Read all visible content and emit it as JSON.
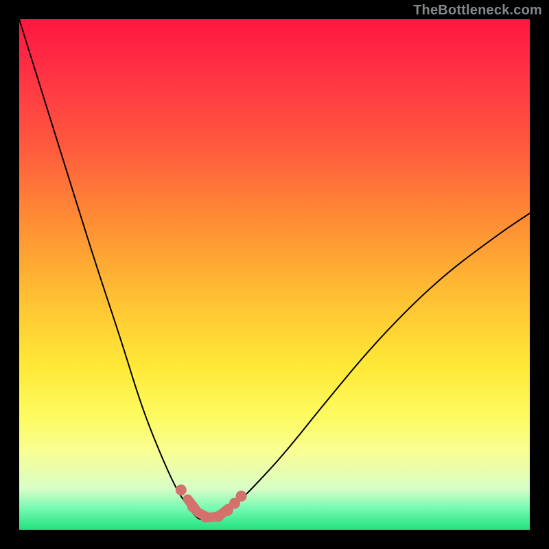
{
  "watermark": {
    "text": "TheBottleneck.com"
  },
  "chart_data": {
    "type": "line",
    "title": "",
    "xlabel": "",
    "ylabel": "",
    "xlim": [
      0,
      100
    ],
    "ylim": [
      0,
      100
    ],
    "series": [
      {
        "name": "bottleneck-curve",
        "x": [
          0,
          5,
          10,
          15,
          20,
          24,
          28,
          31,
          33.5,
          35,
          37,
          39,
          42,
          46,
          52,
          60,
          70,
          82,
          94,
          100
        ],
        "y": [
          100,
          84,
          68,
          52,
          37,
          24,
          14,
          7.5,
          4,
          2,
          2,
          2.5,
          4.5,
          8.5,
          15,
          25,
          37,
          49,
          58,
          62
        ]
      }
    ],
    "accent": {
      "name": "valley-marker",
      "color": "#d4716d",
      "dots": [
        [
          31.7,
          7.8
        ],
        [
          34,
          4.5
        ],
        [
          36.5,
          2.5
        ],
        [
          39,
          2.6
        ],
        [
          40.8,
          3.8
        ],
        [
          42.2,
          5.2
        ],
        [
          43.5,
          6.6
        ]
      ],
      "stroke": [
        [
          33,
          6
        ],
        [
          35,
          3.4
        ],
        [
          37,
          2.4
        ],
        [
          39,
          2.6
        ],
        [
          41,
          4.2
        ]
      ]
    }
  }
}
